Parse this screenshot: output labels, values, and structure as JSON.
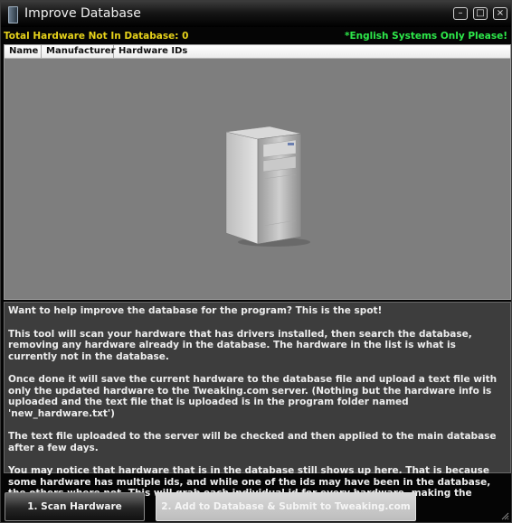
{
  "window": {
    "title": "Improve Database"
  },
  "stats": {
    "total_label": "Total Hardware Not In Database: 0",
    "english_note": "*English Systems Only Please!"
  },
  "list": {
    "columns": [
      "Name",
      "Manufacturer",
      "Hardware IDs"
    ]
  },
  "info": {
    "paragraphs": [
      "Want to help improve the database for the program? This is the spot!",
      "This tool will scan your hardware that has drivers installed, then search the database, removing any hardware already in the database. The hardware in the list is what is currently not in the database.",
      "Once done it will save the current hardware to the database file and upload a text file with only the updated hardware to the Tweaking.com server. (Nothing but the hardware info is uploaded and the text file that is uploaded is in the program folder named 'new_hardware.txt')",
      "The text file uploaded to the server will be checked and then applied to the main database after a few days.",
      "You may notice that hardware that is in the database still shows up here. That is because some hardware has multiple ids, and while one of the ids may have been in the database, the others where not. This will grab each individual id for every hardware, making the database more detailed."
    ]
  },
  "buttons": {
    "scan": "1. Scan Hardware",
    "add_submit": "2. Add to Database & Submit to Tweaking.com"
  },
  "colors": {
    "total_label": "#e6d21a",
    "english_note": "#2de84a"
  }
}
